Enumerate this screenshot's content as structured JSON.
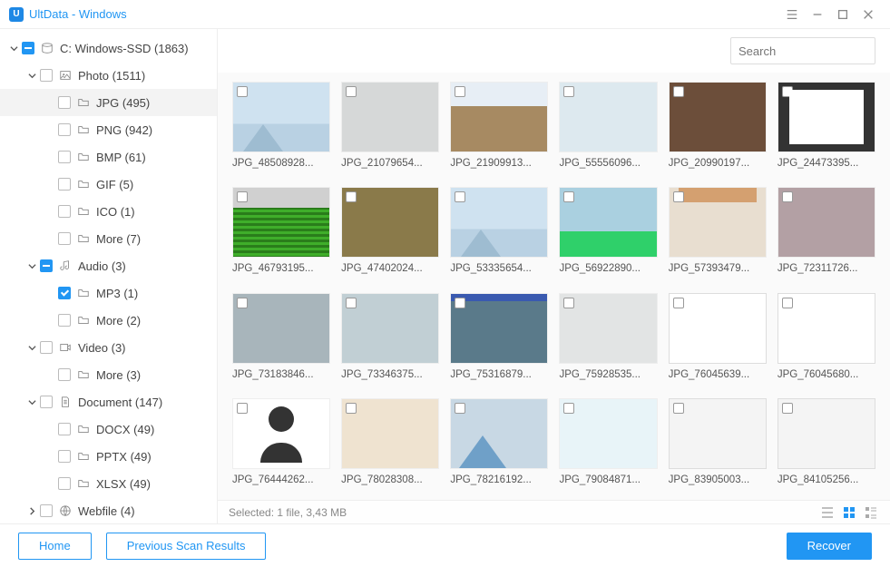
{
  "window": {
    "title": "UltData - Windows"
  },
  "search": {
    "placeholder": "Search"
  },
  "tree": [
    {
      "level": 0,
      "expand": "down",
      "chk": "mixed",
      "icon": "disk",
      "label": "C: Windows-SSD (1863)"
    },
    {
      "level": 1,
      "expand": "down",
      "chk": "empty",
      "icon": "photo",
      "label": "Photo (1511)"
    },
    {
      "level": 2,
      "expand": "",
      "chk": "empty",
      "icon": "folder",
      "label": "JPG (495)",
      "selected": true
    },
    {
      "level": 2,
      "expand": "",
      "chk": "empty",
      "icon": "folder",
      "label": "PNG (942)"
    },
    {
      "level": 2,
      "expand": "",
      "chk": "empty",
      "icon": "folder",
      "label": "BMP (61)"
    },
    {
      "level": 2,
      "expand": "",
      "chk": "empty",
      "icon": "folder",
      "label": "GIF (5)"
    },
    {
      "level": 2,
      "expand": "",
      "chk": "empty",
      "icon": "folder",
      "label": "ICO (1)"
    },
    {
      "level": 2,
      "expand": "",
      "chk": "empty",
      "icon": "folder",
      "label": "More (7)"
    },
    {
      "level": 1,
      "expand": "down",
      "chk": "mixed",
      "icon": "audio",
      "label": "Audio (3)"
    },
    {
      "level": 2,
      "expand": "",
      "chk": "checked",
      "icon": "folder",
      "label": "MP3 (1)"
    },
    {
      "level": 2,
      "expand": "",
      "chk": "empty",
      "icon": "folder",
      "label": "More (2)"
    },
    {
      "level": 1,
      "expand": "down",
      "chk": "empty",
      "icon": "video",
      "label": "Video (3)"
    },
    {
      "level": 2,
      "expand": "",
      "chk": "empty",
      "icon": "folder",
      "label": "More (3)"
    },
    {
      "level": 1,
      "expand": "down",
      "chk": "empty",
      "icon": "doc",
      "label": "Document (147)"
    },
    {
      "level": 2,
      "expand": "",
      "chk": "empty",
      "icon": "folder",
      "label": "DOCX (49)"
    },
    {
      "level": 2,
      "expand": "",
      "chk": "empty",
      "icon": "folder",
      "label": "PPTX (49)"
    },
    {
      "level": 2,
      "expand": "",
      "chk": "empty",
      "icon": "folder",
      "label": "XLSX (49)"
    },
    {
      "level": 1,
      "expand": "right",
      "chk": "empty",
      "icon": "web",
      "label": "Webfile (4)"
    }
  ],
  "thumbs": [
    {
      "label": "JPG_48508928...",
      "variant": "tb-mountain"
    },
    {
      "label": "JPG_21079654...",
      "variant": "tb-grey"
    },
    {
      "label": "JPG_21909913...",
      "variant": "tb-tan"
    },
    {
      "label": "JPG_55556096...",
      "variant": "tb-lightblue"
    },
    {
      "label": "JPG_20990197...",
      "variant": "tb-brown"
    },
    {
      "label": "JPG_24473395...",
      "variant": "tb-screenshot"
    },
    {
      "label": "JPG_46793195...",
      "variant": "tb-green"
    },
    {
      "label": "JPG_47402024...",
      "variant": "tb-olive"
    },
    {
      "label": "JPG_53335654...",
      "variant": "tb-mountain"
    },
    {
      "label": "JPG_56922890...",
      "variant": "tb-greenblob"
    },
    {
      "label": "JPG_57393479...",
      "variant": "tb-beige"
    },
    {
      "label": "JPG_72311726...",
      "variant": "tb-mauve"
    },
    {
      "label": "JPG_73183846...",
      "variant": "tb-slate"
    },
    {
      "label": "JPG_73346375...",
      "variant": "tb-bluegrey"
    },
    {
      "label": "JPG_75316879...",
      "variant": "tb-steel"
    },
    {
      "label": "JPG_75928535...",
      "variant": "tb-palegrey"
    },
    {
      "label": "JPG_76045639...",
      "variant": "tb-doc"
    },
    {
      "label": "JPG_76045680...",
      "variant": "tb-doc"
    },
    {
      "label": "JPG_76444262...",
      "variant": "tb-avatar"
    },
    {
      "label": "JPG_78028308...",
      "variant": "tb-cream"
    },
    {
      "label": "JPG_78216192...",
      "variant": "tb-bluemtn"
    },
    {
      "label": "JPG_79084871...",
      "variant": "tb-ice"
    },
    {
      "label": "JPG_83905003...",
      "variant": "tb-docgrey"
    },
    {
      "label": "JPG_84105256...",
      "variant": "tb-docgrey"
    }
  ],
  "status": {
    "text": "Selected: 1 file, 3,43 MB"
  },
  "footer": {
    "home": "Home",
    "prev": "Previous Scan Results",
    "recover": "Recover"
  }
}
